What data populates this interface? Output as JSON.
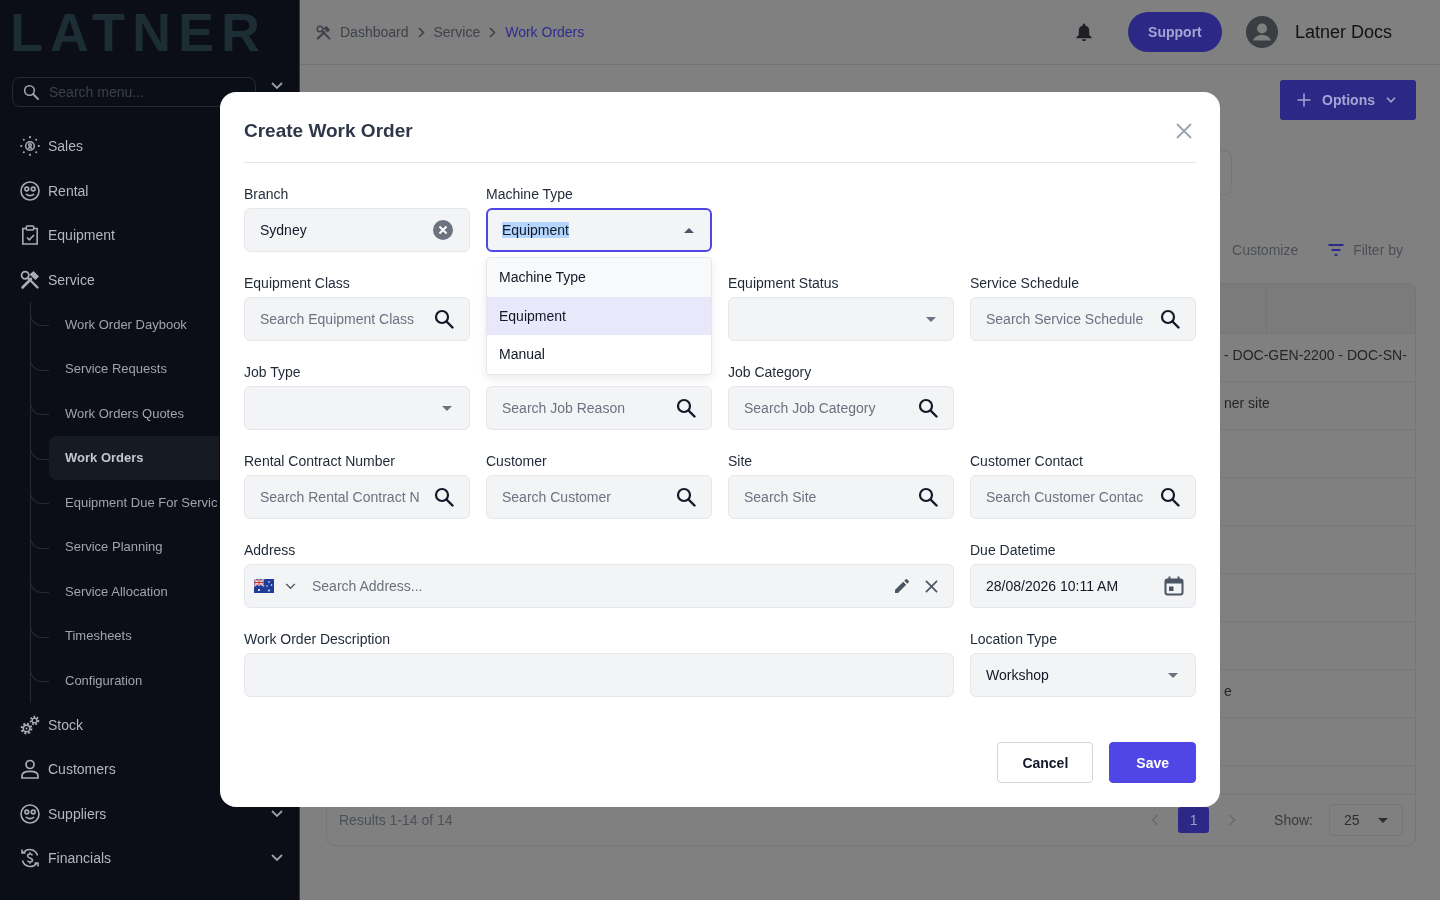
{
  "sidebar": {
    "logo": "LATNER",
    "search": {
      "placeholder": "Search menu..."
    },
    "items": [
      {
        "label": "Sales",
        "selected": false
      },
      {
        "label": "Rental",
        "selected": false
      },
      {
        "label": "Equipment",
        "selected": false
      },
      {
        "label": "Service",
        "selected": false,
        "expanded": true,
        "children": [
          {
            "label": "Work Order Daybook",
            "selected": false
          },
          {
            "label": "Service Requests",
            "selected": false
          },
          {
            "label": "Work Orders Quotes",
            "selected": false
          },
          {
            "label": "Work Orders",
            "selected": true
          },
          {
            "label": "Equipment Due For Servic",
            "selected": false
          },
          {
            "label": "Service Planning",
            "selected": false
          },
          {
            "label": "Service Allocation",
            "selected": false
          },
          {
            "label": "Timesheets",
            "selected": false
          },
          {
            "label": "Configuration",
            "selected": false
          }
        ]
      },
      {
        "label": "Stock",
        "selected": false
      },
      {
        "label": "Customers",
        "selected": false
      },
      {
        "label": "Suppliers",
        "selected": false,
        "expanded": false
      },
      {
        "label": "Financials",
        "selected": false,
        "expanded": false
      }
    ]
  },
  "topbar": {
    "breadcrumb": [
      {
        "label": "Dashboard",
        "selected": false
      },
      {
        "label": "Service",
        "selected": false
      },
      {
        "label": "Work Orders",
        "selected": true
      }
    ],
    "support_button": "Support",
    "user_name": "Latner Docs"
  },
  "page": {
    "options_button": "Options",
    "toolbar": {
      "customize": "Customize",
      "filter": "Filter by"
    },
    "table": {
      "rows": [
        {
          "column_1": "- DOC-GEN-2200 - DOC-SN-"
        },
        {
          "column_1": "ner site"
        },
        {},
        {},
        {},
        {},
        {},
        {
          "column_1": "e"
        },
        {}
      ]
    },
    "pagination": {
      "results": "Results 1-14 of 14",
      "pages": [
        {
          "label": "1",
          "selected": true
        }
      ],
      "show_label": "Show:",
      "page_size": "25"
    }
  },
  "modal": {
    "title": "Create Work Order",
    "rows": [
      [
        {
          "label": "Branch",
          "kind": "clearable",
          "value": "Sydney"
        },
        {
          "label": "Machine Type",
          "kind": "select",
          "value": "Equipment",
          "expanded": true,
          "options": [
            {
              "label": "Machine Type",
              "kind": "placeholder",
              "selected": false
            },
            {
              "label": "Equipment",
              "kind": "option",
              "selected": true
            },
            {
              "label": "Manual",
              "kind": "option",
              "selected": false
            }
          ]
        }
      ],
      [
        {
          "label": "Equipment Class",
          "kind": "search",
          "placeholder": "Search Equipment Class"
        },
        "",
        {
          "label": "Equipment Status",
          "kind": "select",
          "expanded": false
        },
        {
          "label": "Service Schedule",
          "kind": "search",
          "placeholder": "Search Service Schedule"
        }
      ],
      [
        {
          "label": "Job Type",
          "kind": "select",
          "expanded": false
        },
        {
          "kind": "search",
          "placeholder": "Search Job Reason"
        },
        {
          "label": "Job Category",
          "kind": "search",
          "placeholder": "Search Job Category"
        }
      ],
      [
        {
          "label": "Rental Contract Number",
          "kind": "search",
          "placeholder": "Search Rental Contract N"
        },
        {
          "label": "Customer",
          "kind": "search",
          "placeholder": "Search Customer"
        },
        {
          "label": "Site",
          "kind": "search",
          "placeholder": "Search Site"
        },
        {
          "label": "Customer Contact",
          "kind": "search",
          "placeholder": "Search Customer Contac"
        }
      ],
      [
        {
          "label": "Address",
          "kind": "address",
          "placeholder": "Search Address..."
        },
        {
          "label": "Due Datetime",
          "kind": "date",
          "value": "28/08/2026 10:11 AM"
        }
      ],
      [
        {
          "label": "Work Order Description",
          "kind": "textarea"
        },
        {
          "label": "Location Type",
          "kind": "select",
          "value": "Workshop",
          "expanded": false
        }
      ]
    ],
    "buttons": [
      {
        "label": "Cancel",
        "kind": "secondary"
      },
      {
        "label": "Save",
        "kind": "primary"
      }
    ]
  }
}
